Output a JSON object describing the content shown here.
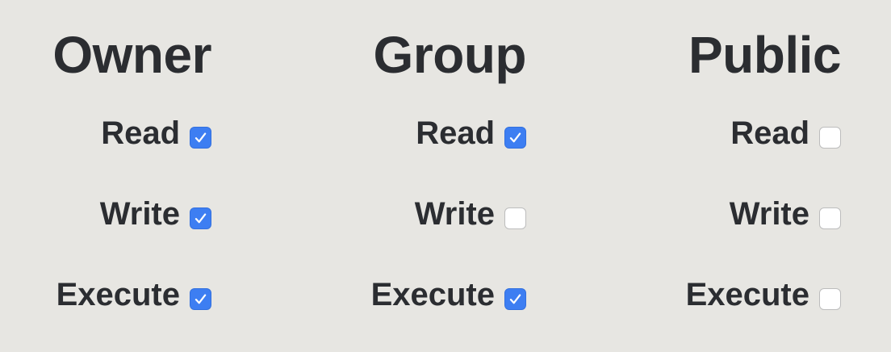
{
  "permissions": {
    "columns": [
      {
        "heading": "Owner",
        "rows": [
          {
            "label": "Read",
            "checked": true
          },
          {
            "label": "Write",
            "checked": true
          },
          {
            "label": "Execute",
            "checked": true
          }
        ]
      },
      {
        "heading": "Group",
        "rows": [
          {
            "label": "Read",
            "checked": true
          },
          {
            "label": "Write",
            "checked": false
          },
          {
            "label": "Execute",
            "checked": true
          }
        ]
      },
      {
        "heading": "Public",
        "rows": [
          {
            "label": "Read",
            "checked": false
          },
          {
            "label": "Write",
            "checked": false
          },
          {
            "label": "Execute",
            "checked": false
          }
        ]
      }
    ]
  },
  "colors": {
    "background": "#e7e6e2",
    "text": "#2b2d31",
    "accent": "#3d7ef2",
    "unchecked_fill": "#ffffff",
    "unchecked_border": "#bdbdbd"
  },
  "icons": {
    "checked": "checkmark-icon"
  }
}
